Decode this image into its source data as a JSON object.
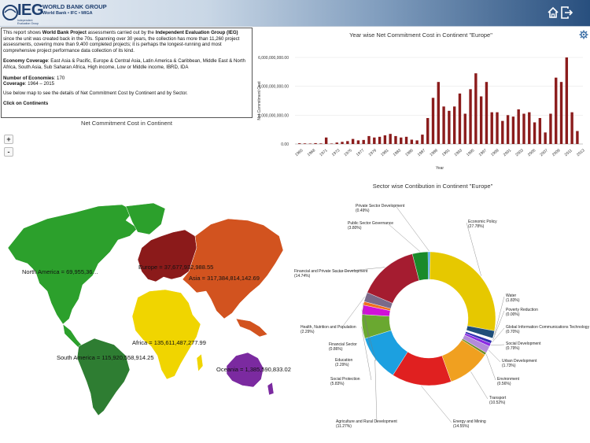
{
  "header": {
    "logo_ieg": "IEG",
    "logo_line1": "WORLD BANK GROUP",
    "logo_line2": "World Bank • IFC • MIGA",
    "logo_tiny": "Independent Evaluation Group",
    "home_icon": "home-icon",
    "exit_icon": "exit-icon"
  },
  "info": {
    "p1_a": "This report shows ",
    "p1_b": "World Bank Project",
    "p1_c": " assessments carried out by the ",
    "p1_d": "Independent Evaluation Group (IEG)",
    "p1_e": " since the unit was created back in the 70s. Spanning over 30 years, the collection has more than 11,260 project assessments, covering more than 9,400 completed projects; it is perhaps the longest-running and most comprehensive project performance data collection of its kind.",
    "coverage_label": "Economy Coverage",
    "coverage_text": ": East Asia & Pacific, Europe & Central Asia, Latin America & Caribbean, Middle East & North Africa, South Asia, Sub Saharan Africa, High income, Low or Middle income, IBRD, IDA",
    "num_label": "Number of Economies",
    "num_value": ": 170",
    "cov_label": "Coverage",
    "cov_value": ": 1964 – 2015",
    "instruction": "Use below map to see the details of Net Commitment Cost by Continent and by Sector.",
    "click": "Click on Continents"
  },
  "map": {
    "title": "Net Commitment Cost in Continent",
    "zoom_in": "+",
    "zoom_out": "-",
    "continents": [
      {
        "name": "North America",
        "label": "North America = 69,955,36…",
        "color": "#2ca02c"
      },
      {
        "name": "South America",
        "label": "South America = 115,920,558,914.25",
        "color": "#2e7d32"
      },
      {
        "name": "Europe",
        "label": "Europe = 37,677,932,988.55",
        "color": "#8b1a1a"
      },
      {
        "name": "Asia",
        "label": "Asia = 317,384,814,142.69",
        "color": "#d2531f"
      },
      {
        "name": "Africa",
        "label": "Africa = 135,611,487,277.99",
        "color": "#f0d500"
      },
      {
        "name": "Oceania",
        "label": "Oceania = 1,385,590,833.02",
        "color": "#7b2aa0"
      }
    ]
  },
  "chart_data": [
    {
      "type": "bar",
      "title": "Year wise Net Commitment Cost in Continent  \"Europe\"",
      "xlabel": "Year",
      "ylabel": "Net Commitment Cost",
      "ylim": [
        0,
        6000000000
      ],
      "yticks": [
        "0.00",
        "2,000,000,000.00",
        "4,000,000,000.00",
        "6,000,000,000.00"
      ],
      "xticks": [
        "1965",
        "1968",
        "1971",
        "1973",
        "1975",
        "1977",
        "1979",
        "1981",
        "1983",
        "1985",
        "1987",
        "1989",
        "1991",
        "1993",
        "1995",
        "1997",
        "1999",
        "2001",
        "2003",
        "2005",
        "2007",
        "2009",
        "2011",
        "2013"
      ],
      "color": "#8b1c1c",
      "values": [
        50000000,
        40000000,
        30000000,
        60000000,
        40000000,
        450000000,
        30000000,
        100000000,
        150000000,
        200000000,
        350000000,
        250000000,
        280000000,
        550000000,
        450000000,
        500000000,
        600000000,
        700000000,
        550000000,
        450000000,
        500000000,
        300000000,
        250000000,
        650000000,
        1800000000,
        3200000000,
        4300000000,
        2600000000,
        2300000000,
        2600000000,
        3500000000,
        2100000000,
        3800000000,
        4900000000,
        3300000000,
        4300000000,
        2200000000,
        2200000000,
        1600000000,
        2000000000,
        1900000000,
        2400000000,
        2100000000,
        2200000000,
        1500000000,
        1800000000,
        800000000,
        2100000000,
        4600000000,
        4300000000,
        6000000000,
        2200000000,
        900000000
      ]
    },
    {
      "type": "pie",
      "title": "Sector wise Contibution in Continent  \"Europe\"",
      "slices": [
        {
          "label": "Economic Policy",
          "pct": "(27.78%)",
          "value": 27.78,
          "color": "#e6c800"
        },
        {
          "label": "Water",
          "pct": "(1.83%)",
          "value": 1.83,
          "color": "#1f4e79"
        },
        {
          "label": "Poverty Reduction",
          "pct": "(0.00%)",
          "value": 0.6,
          "color": "#ffffff"
        },
        {
          "label": "Global Information Communications Technology",
          "pct": "(0.70%)",
          "value": 0.7,
          "color": "#2f2fb0"
        },
        {
          "label": "Social Development",
          "pct": "(0.79%)",
          "value": 0.79,
          "color": "#8a2be2"
        },
        {
          "label": "Urban Development",
          "pct": "(1.73%)",
          "value": 1.73,
          "color": "#b38bd9"
        },
        {
          "label": "Environment",
          "pct": "(0.56%)",
          "value": 0.56,
          "color": "#6b8e23"
        },
        {
          "label": "Transport",
          "pct": "(10.52%)",
          "value": 10.52,
          "color": "#f0a020"
        },
        {
          "label": "Energy and Mining",
          "pct": "(14.55%)",
          "value": 14.55,
          "color": "#e02020"
        },
        {
          "label": "Agriculture and Rural Development",
          "pct": "(11.27%)",
          "value": 11.27,
          "color": "#1ca0e0"
        },
        {
          "label": "Social Protection",
          "pct": "(5.83%)",
          "value": 5.83,
          "color": "#6aa830"
        },
        {
          "label": "Education",
          "pct": "(2.29%)",
          "value": 2.29,
          "color": "#d010d8"
        },
        {
          "label": "Financial Sector",
          "pct": "(0.86%)",
          "value": 0.86,
          "color": "#f07020"
        },
        {
          "label": "Health, Nutrition and Population",
          "pct": "(2.29%)",
          "value": 2.29,
          "color": "#7a6a8a"
        },
        {
          "label": "Financial and Private Sector Development",
          "pct": "(14.74%)",
          "value": 14.74,
          "color": "#a51c30"
        },
        {
          "label": "Public Sector Governance",
          "pct": "(3.80%)",
          "value": 3.8,
          "color": "#1a8a2a"
        },
        {
          "label": "Private Sector Development",
          "pct": "(0.49%)",
          "value": 0.49,
          "color": "#3aa0e8"
        }
      ]
    }
  ]
}
